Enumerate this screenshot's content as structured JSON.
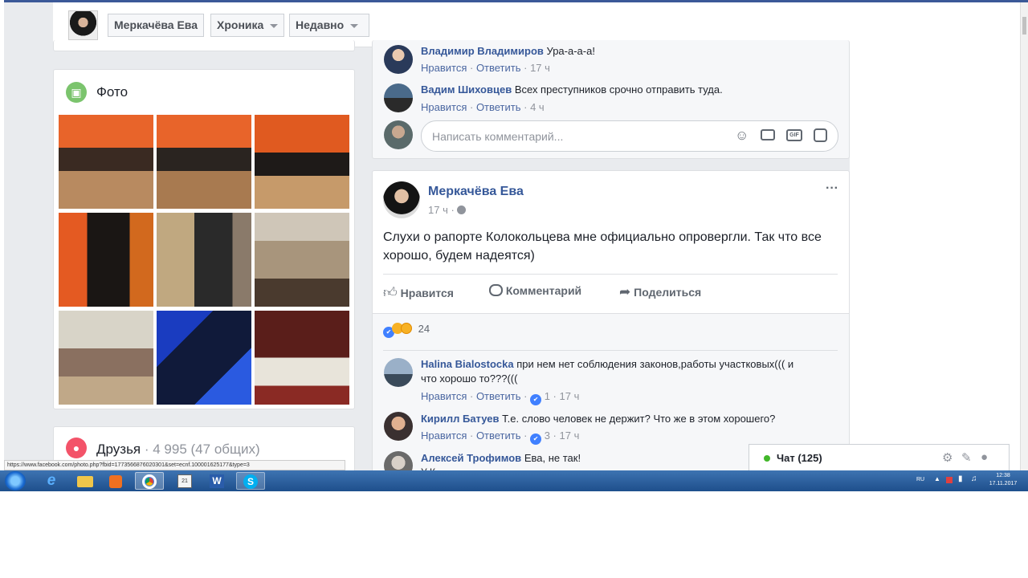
{
  "header": {
    "name_button": "Меркачёва Ева",
    "timeline_button": "Хроника",
    "recent_button": "Недавно"
  },
  "photos": {
    "title": "Фото"
  },
  "friends": {
    "title": "Друзья",
    "count": "· 4 995 (47 общих)"
  },
  "status_bar": {
    "url": "https://www.facebook.com/photo.php?fbid=1773566876020301&set=ecnf.100001625177&type=3"
  },
  "prev_post": {
    "comments": [
      {
        "author": "Владимир Владимиров",
        "text": "Ура-а-а-а!",
        "like": "Нравится",
        "reply": "Ответить",
        "time": "17 ч"
      },
      {
        "author": "Вадим Шиховцев",
        "text": "Всех преступников срочно отправить туда.",
        "like": "Нравится",
        "reply": "Ответить",
        "time": "4 ч"
      }
    ],
    "comment_placeholder": "Написать комментарий..."
  },
  "post": {
    "author": "Меркачёва Ева",
    "time": "17 ч",
    "text_line1": "Слухи о рапорте Колокольцева мне официально опровергли. Так что все",
    "text_line2": "хорошо, будем надеятся)",
    "like_button": "Нравится",
    "comment_button": "Комментарий",
    "share_button": "Поделиться",
    "reactions_count": "24",
    "menu": "···",
    "comments": [
      {
        "author": "Halina Bialostocka",
        "text1": "при нем нет соблюдения законов,работы участковых((( и",
        "text2": "что хорошо то???(((",
        "like": "Нравится",
        "reply": "Ответить",
        "likes": "1",
        "time": "17 ч"
      },
      {
        "author": "Кирилл Батуев",
        "text1": "Т.е. слово человек не держит? Что же в этом хорошего?",
        "like": "Нравится",
        "reply": "Ответить",
        "likes": "3",
        "time": "17 ч"
      },
      {
        "author": "Алексей Трофимов",
        "text1": "Ева, не так!",
        "partial": "У К"
      }
    ]
  },
  "chat": {
    "label": "Чат (125)"
  },
  "taskbar": {
    "lang": "RU",
    "time": "12:38",
    "date": "17.11.2017"
  },
  "colors": {
    "fb_blue": "#3b5998",
    "link_blue": "#365899",
    "like_blue": "#4080ff",
    "online_green": "#42b72a"
  }
}
